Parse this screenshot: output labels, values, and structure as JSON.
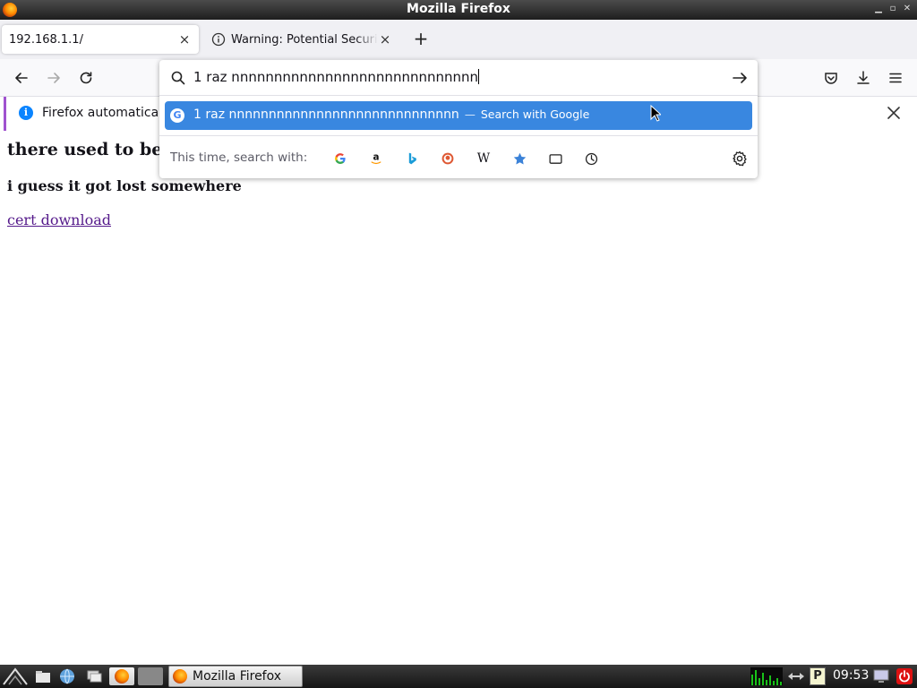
{
  "window": {
    "title": "Mozilla Firefox"
  },
  "tabs": [
    {
      "label": "192.168.1.1/",
      "close": "×"
    },
    {
      "label": "Warning: Potential Security Risk Ahead",
      "close": "×"
    }
  ],
  "newtab": "+",
  "notification": {
    "text": "Firefox automatically"
  },
  "url_popup": {
    "typed_text": "1 raz nnnnnnnnnnnnnnnnnnnnnnnnnnnnn",
    "suggestion": {
      "text": "1 raz nnnnnnnnnnnnnnnnnnnnnnnnnnnnn",
      "separator": "—",
      "action": "Search with Google"
    },
    "search_with_label": "This time, search with:",
    "engines": [
      "google-icon",
      "amazon-icon",
      "bing-icon",
      "duckduckgo-icon",
      "wikipedia-icon",
      "bookmarks-icon",
      "tabs-icon",
      "history-icon"
    ]
  },
  "page": {
    "heading": "there used to be",
    "subheading": "i guess it got lost somewhere",
    "link": "cert download"
  },
  "taskbar": {
    "window_label": "Mozilla Firefox",
    "clock": "09:53"
  },
  "colors": {
    "accent": "#3987e0",
    "link_visited": "#551a8b",
    "notification_stripe": "#a052cf"
  }
}
